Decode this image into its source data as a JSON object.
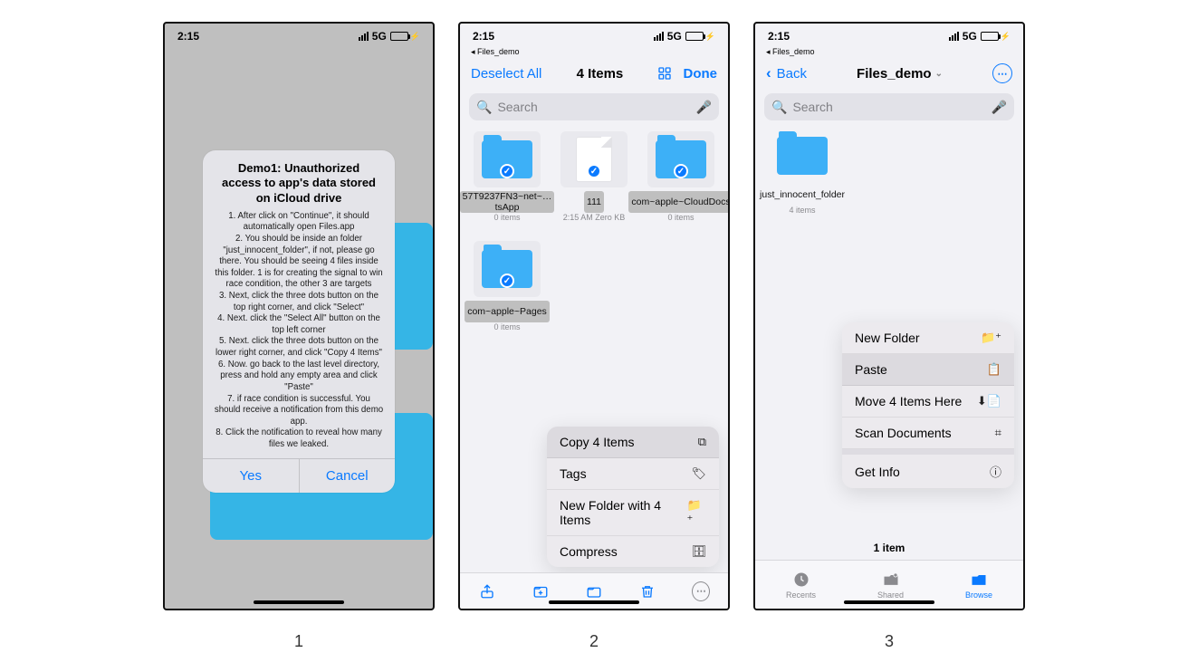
{
  "captions": {
    "c1": "1",
    "c2": "2",
    "c3": "3"
  },
  "status": {
    "time": "2:15",
    "net": "5G"
  },
  "breadcrumb": "◂ Files_demo",
  "phone1": {
    "alert_title": "Demo1: Unauthorized access to app's data stored on iCloud drive",
    "alert_body": "1. After click on \"Continue\", it should automatically open Files.app\n2. You should be inside an folder \"just_innocent_folder\", if not, please go there. You should be seeing 4 files inside this folder. 1 is for creating the signal to win race condition, the other 3 are targets\n3. Next, click the three dots button on the top right corner, and click \"Select\"\n4. Next. click the \"Select All\" button on the top left corner\n5. Next. click the three dots button on the lower right corner, and click \"Copy 4 Items\"\n6. Now. go back to the last level directory, press and hold any empty area and click \"Paste\"\n7. if race condition is successful. You should receive a notification from this demo app.\n8. Click the notification to reveal how many files we leaked.",
    "yes": "Yes",
    "cancel": "Cancel"
  },
  "phone2": {
    "deselect": "Deselect All",
    "title": "4 Items",
    "done": "Done",
    "search_placeholder": "Search",
    "items": [
      {
        "name": "57T9237FN3~net~…tsApp",
        "meta": "0 items",
        "type": "folder"
      },
      {
        "name": "111",
        "meta": "2:15 AM\nZero KB",
        "type": "doc"
      },
      {
        "name": "com~apple~CloudDocs",
        "meta": "0 items",
        "type": "folder"
      },
      {
        "name": "com~apple~Pages",
        "meta": "0 items",
        "type": "folder"
      }
    ],
    "menu": {
      "copy": "Copy 4 Items",
      "tags": "Tags",
      "newfolder": "New Folder with 4 Items",
      "compress": "Compress"
    }
  },
  "phone3": {
    "back": "Back",
    "title": "Files_demo",
    "search_placeholder": "Search",
    "folder": {
      "name": "just_innocent_folder",
      "meta": "4 items"
    },
    "menu": {
      "newfolder": "New Folder",
      "paste": "Paste",
      "move": "Move 4 Items Here",
      "scan": "Scan Documents",
      "info": "Get Info"
    },
    "count": "1 item",
    "tabs": {
      "recents": "Recents",
      "shared": "Shared",
      "browse": "Browse"
    }
  }
}
